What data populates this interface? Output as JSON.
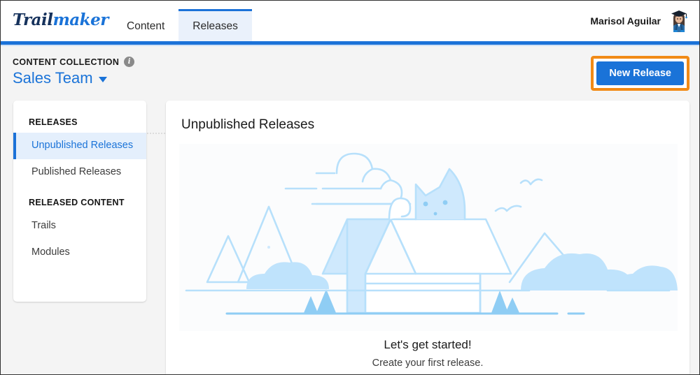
{
  "brand": {
    "logo_part1": "Trail",
    "logo_part2": "maker",
    "accent_blue": "#1a73d8",
    "highlight_orange": "#f18a16",
    "active_tab_bg": "#eaf1fb"
  },
  "topnav": {
    "tabs": [
      {
        "label": "Content",
        "active": false
      },
      {
        "label": "Releases",
        "active": true
      }
    ],
    "user": {
      "name": "Marisol Aguilar",
      "avatar_icon": "user-avatar-graduate-icon"
    }
  },
  "subheader": {
    "collection_label": "CONTENT COLLECTION",
    "info_icon": "info-circle-icon",
    "collection_name": "Sales Team",
    "caret_icon": "chevron-down-icon",
    "new_release_label": "New Release"
  },
  "sidebar": {
    "sections": [
      {
        "heading": "RELEASES",
        "items": [
          {
            "label": "Unpublished Releases",
            "active": true
          },
          {
            "label": "Published Releases",
            "active": false
          }
        ]
      },
      {
        "heading": "RELEASED CONTENT",
        "items": [
          {
            "label": "Trails",
            "active": false
          },
          {
            "label": "Modules",
            "active": false
          }
        ]
      }
    ]
  },
  "main": {
    "title": "Unpublished Releases",
    "illustration_name": "cat-in-open-box-landscape-illustration",
    "empty_title": "Let's get started!",
    "empty_subtitle": "Create your first release."
  }
}
